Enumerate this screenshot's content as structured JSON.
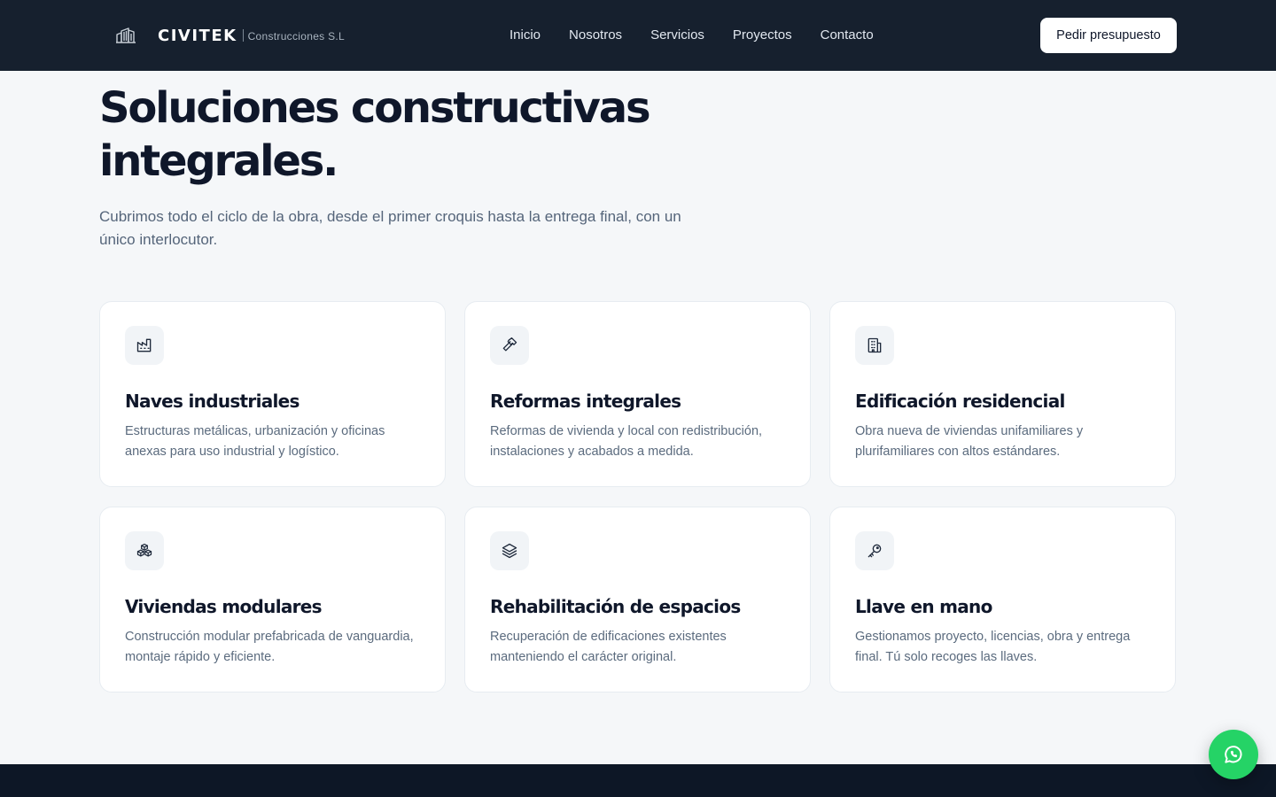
{
  "header": {
    "brand_name": "CIVITEK",
    "brand_sub": "Construcciones S.L",
    "logo_icon": "building-outline-icon",
    "nav": [
      "Inicio",
      "Nosotros",
      "Servicios",
      "Proyectos",
      "Contacto"
    ],
    "cta_label": "Pedir presupuesto"
  },
  "hero": {
    "title": "Soluciones constructivas integrales.",
    "subtitle": "Cubrimos todo el ciclo de la obra, desde el primer croquis hasta la entrega final, con un único interlocutor."
  },
  "services": [
    {
      "icon": "factory-icon",
      "title": "Naves industriales",
      "text": "Estructuras metálicas, urbanización y oficinas anexas para uso industrial y logístico."
    },
    {
      "icon": "hammer-icon",
      "title": "Reformas integrales",
      "text": "Reformas de vivienda y local con redistribución, instalaciones y acabados a medida."
    },
    {
      "icon": "building-icon",
      "title": "Edificación residencial",
      "text": "Obra nueva de viviendas unifamiliares y plurifamiliares con altos estándares."
    },
    {
      "icon": "boxes-icon",
      "title": "Viviendas modulares",
      "text": "Construcción modular prefabricada de vanguardia, montaje rápido y eficiente."
    },
    {
      "icon": "layers-icon",
      "title": "Rehabilitación de espacios",
      "text": "Recuperación de edificaciones existentes manteniendo el carácter original."
    },
    {
      "icon": "key-icon",
      "title": "Llave en mano",
      "text": "Gestionamos proyecto, licencias, obra y entrega final. Tú solo recoges las llaves."
    }
  ],
  "whatsapp": {
    "icon": "whatsapp-icon"
  },
  "colors": {
    "header_bg": "#16202e",
    "page_bg": "#f5f7f9",
    "footer_bg": "#0d1726",
    "whatsapp": "#25d366",
    "text_dark": "#0f172a",
    "text_muted": "#5b6b7e"
  }
}
